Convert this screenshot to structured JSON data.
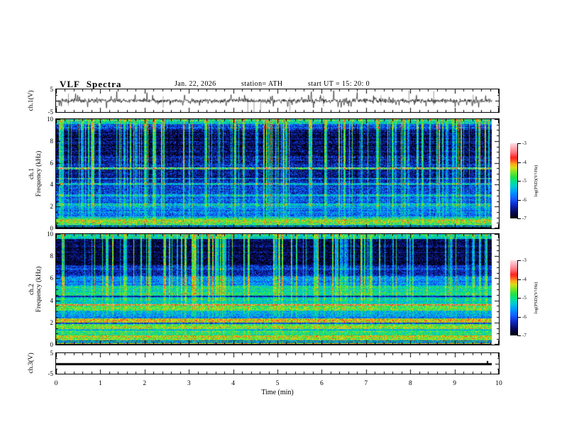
{
  "header": {
    "title": "VLF Spectra",
    "date": "Jan. 22, 2026",
    "station": "station= ATH",
    "start_ut": "start UT  =   15: 20: 0"
  },
  "x_axis": {
    "label": "Time (min)",
    "min": 0,
    "max": 10,
    "major_ticks": [
      0,
      1,
      2,
      3,
      4,
      5,
      6,
      7,
      8,
      9,
      10
    ],
    "minor_step": 0.2,
    "data_end_min": 9.84
  },
  "colorbar": {
    "label": "log(PSD)(V²/Hz)",
    "min": -7,
    "max": -3,
    "ticks": [
      -3,
      -4,
      -5,
      -6,
      -7
    ]
  },
  "colormap": {
    "stops": [
      [
        -7.05,
        0,
        0,
        0
      ],
      [
        -6.65,
        8,
        10,
        95
      ],
      [
        -6.25,
        16,
        45,
        205
      ],
      [
        -5.95,
        20,
        95,
        255
      ],
      [
        -5.6,
        0,
        155,
        255
      ],
      [
        -5.3,
        0,
        205,
        210
      ],
      [
        -5.05,
        0,
        225,
        145
      ],
      [
        -4.8,
        35,
        225,
        70
      ],
      [
        -4.55,
        115,
        230,
        40
      ],
      [
        -4.3,
        215,
        225,
        25
      ],
      [
        -4.1,
        255,
        170,
        20
      ],
      [
        -3.92,
        255,
        85,
        35
      ],
      [
        -3.75,
        255,
        35,
        30
      ],
      [
        -3.5,
        255,
        110,
        120
      ],
      [
        -3.2,
        255,
        175,
        185
      ],
      [
        -2.95,
        255,
        228,
        232
      ]
    ]
  },
  "chart_data": [
    {
      "type": "line",
      "name": "ch1-waveform",
      "ylabel": "ch.1(V)",
      "ylim": [
        -5,
        5
      ],
      "yticks": [
        5,
        -5
      ],
      "noise_sigma": 0.45,
      "seed": 7,
      "spike_count": 70,
      "spike_amp": [
        1.2,
        3.2
      ],
      "gray_spikes": [
        {
          "x": 0.28,
          "top": 3.2,
          "bottom": -2.2
        },
        {
          "x": 2.42,
          "top": 2.0,
          "bottom": -3.0
        },
        {
          "x": 4.33,
          "top": 1.2,
          "bottom": -5.0
        },
        {
          "x": 4.47,
          "top": 1.0,
          "bottom": -5.0
        },
        {
          "x": 4.62,
          "top": 0.8,
          "bottom": -4.2
        },
        {
          "x": 5.28,
          "top": 1.5,
          "bottom": -4.6
        },
        {
          "x": 6.04,
          "top": 2.2,
          "bottom": -2.6
        },
        {
          "x": 7.34,
          "top": 2.4,
          "bottom": -2.0
        },
        {
          "x": 7.97,
          "top": 4.6,
          "bottom": -1.6
        },
        {
          "x": 8.53,
          "top": 4.2,
          "bottom": -2.0
        },
        {
          "x": 9.42,
          "top": 2.6,
          "bottom": -1.8
        }
      ]
    },
    {
      "type": "heatmap",
      "name": "ch1-spectrogram",
      "ylabel1": "ch.1",
      "ylabel2": "Frequency (kHz)",
      "ylim": [
        0,
        10
      ],
      "yticks": [
        10,
        8,
        6,
        4,
        2,
        0
      ],
      "seed": 42,
      "pixel_noise": 0.55,
      "row_noise": 0.25,
      "bands": [
        [
          0,
          0.12,
          -7.2
        ],
        [
          0.12,
          0.18,
          -5.3
        ],
        [
          0.18,
          0.24,
          -6.6
        ],
        [
          0.24,
          0.3,
          -5.0
        ],
        [
          0.3,
          0.55,
          -4.75,
          1.2
        ],
        [
          0.55,
          0.85,
          -4.45
        ],
        [
          0.85,
          1.0,
          -5.05
        ],
        [
          1.0,
          2.1,
          -5.75
        ],
        [
          2.1,
          2.3,
          -5.2
        ],
        [
          2.3,
          2.9,
          -5.95
        ],
        [
          2.9,
          3.1,
          -5.3
        ],
        [
          3.1,
          3.95,
          -6.15
        ],
        [
          3.95,
          4.15,
          -5.35
        ],
        [
          4.15,
          4.45,
          -6.5
        ],
        [
          4.45,
          4.6,
          -5.7
        ],
        [
          4.6,
          5.4,
          -6.55
        ],
        [
          5.4,
          5.6,
          -5.0,
          1.6
        ],
        [
          5.6,
          6.1,
          -6.3
        ],
        [
          6.1,
          6.6,
          -6.45
        ],
        [
          6.6,
          9.0,
          -6.6
        ],
        [
          9.0,
          9.55,
          -6.1
        ],
        [
          9.55,
          9.85,
          -5.15
        ],
        [
          9.85,
          10,
          -4.9,
          1.5
        ]
      ],
      "streaks": {
        "density": 0.22,
        "boost_min": 1.0,
        "boost_max": 2.2,
        "dark_prob": 0.07,
        "dark_boost": -0.4,
        "profile": [
          [
            0,
            1,
            0.12
          ],
          [
            1,
            2,
            0.3
          ],
          [
            2,
            4,
            0.5
          ],
          [
            4,
            6,
            0.75
          ],
          [
            6,
            9.55,
            1.0
          ],
          [
            9.55,
            10,
            0.45
          ]
        ]
      }
    },
    {
      "type": "heatmap",
      "name": "ch2-spectrogram",
      "ylabel1": "ch.2",
      "ylabel2": "Frequency (kHz)",
      "ylim": [
        0,
        10
      ],
      "yticks": [
        10,
        8,
        6,
        4,
        2,
        0
      ],
      "seed": 1337,
      "pixel_noise": 0.5,
      "row_noise": 0.25,
      "bands": [
        [
          0,
          0.06,
          -7.2
        ],
        [
          0.06,
          0.13,
          -4.3
        ],
        [
          0.13,
          0.2,
          -5.0
        ],
        [
          0.2,
          0.26,
          -6.3
        ],
        [
          0.26,
          0.3,
          -4.8
        ],
        [
          0.3,
          0.36,
          -6.3
        ],
        [
          0.36,
          0.85,
          -4.45
        ],
        [
          0.85,
          1.25,
          -4.85
        ],
        [
          1.25,
          1.4,
          -5.35
        ],
        [
          1.4,
          1.85,
          -4.6
        ],
        [
          1.85,
          2.0,
          -6.2
        ],
        [
          2.0,
          2.4,
          -4.3
        ],
        [
          2.4,
          2.55,
          -5.85
        ],
        [
          2.55,
          3.05,
          -5.45
        ],
        [
          3.05,
          3.5,
          -4.75
        ],
        [
          3.5,
          3.65,
          -3.95
        ],
        [
          3.65,
          4.3,
          -5.2
        ],
        [
          4.3,
          4.45,
          -6.4
        ],
        [
          4.45,
          5.3,
          -5.15
        ],
        [
          5.3,
          6.2,
          -5.65
        ],
        [
          6.2,
          7.2,
          -6.25
        ],
        [
          7.2,
          9.55,
          -6.7
        ],
        [
          9.55,
          9.85,
          -5.2
        ],
        [
          9.85,
          10,
          -4.9,
          1.4
        ]
      ],
      "streaks": {
        "density": 0.2,
        "boost_min": 1.0,
        "boost_max": 2.4,
        "dark_prob": 0.06,
        "dark_boost": -0.35,
        "profile": [
          [
            0,
            2.5,
            0.08
          ],
          [
            2.5,
            4,
            0.18
          ],
          [
            4,
            5.3,
            0.35
          ],
          [
            5.3,
            7.2,
            0.7
          ],
          [
            7.2,
            9.55,
            1.0
          ],
          [
            9.55,
            10,
            0.4
          ]
        ]
      }
    },
    {
      "type": "line",
      "name": "ch3-waveform",
      "ylabel": "ch.3(V)",
      "ylim": [
        -5,
        5
      ],
      "yticks": [
        5,
        -5
      ],
      "value": 0,
      "line_width": 3,
      "spike": {
        "x": 9.72,
        "height": 0.9
      }
    }
  ]
}
